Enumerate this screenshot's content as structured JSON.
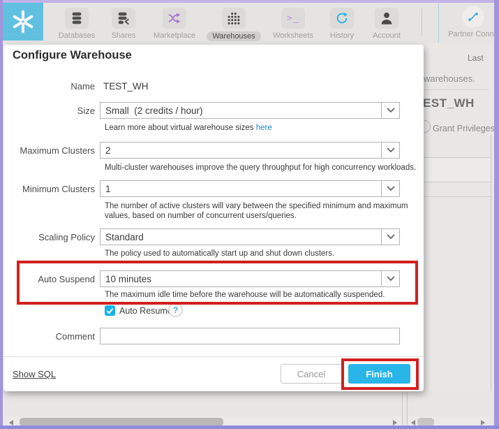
{
  "topbar": {
    "items": [
      {
        "label": "Databases"
      },
      {
        "label": "Shares"
      },
      {
        "label": "Marketplace"
      },
      {
        "label": "Warehouses"
      },
      {
        "label": "Worksheets"
      },
      {
        "label": "History"
      },
      {
        "label": "Account"
      }
    ],
    "partner_connect_label": "Partner Conne",
    "worksheets_glyph": ">_"
  },
  "modal": {
    "title": "Configure Warehouse",
    "name_field": {
      "label": "Name",
      "value": "TEST_WH"
    },
    "size_field": {
      "label": "Size",
      "value": "Small  (2 credits / hour)",
      "help_prefix": "Learn more about virtual warehouse sizes ",
      "help_link": "here"
    },
    "max_clusters_field": {
      "label": "Maximum Clusters",
      "value": "2",
      "help": "Multi-cluster warehouses improve the query throughput for high concurrency workloads."
    },
    "min_clusters_field": {
      "label": "Minimum Clusters",
      "value": "1",
      "help": "The number of active clusters will vary between the specified minimum and maximum values, based on number of concurrent users/queries."
    },
    "scaling_policy_field": {
      "label": "Scaling Policy",
      "value": "Standard",
      "help": "The policy used to automatically start up and shut down clusters."
    },
    "auto_suspend_field": {
      "label": "Auto Suspend",
      "value": "10 minutes",
      "help": "The maximum idle time before the warehouse will be automatically suspended."
    },
    "auto_resume": {
      "label": "Auto Resume",
      "checked": true,
      "help_glyph": "?"
    },
    "comment_field": {
      "label": "Comment",
      "value": ""
    },
    "footer": {
      "show_sql_label": "Show SQL",
      "cancel_label": "Cancel",
      "finish_label": "Finish"
    }
  },
  "right_panel": {
    "last_label": "Last",
    "partial_text": "warehouses.",
    "warehouse_title": "EST_WH",
    "grant_privileges_label": "Grant Privileges"
  },
  "colors": {
    "accent_blue": "#29b5e8",
    "logo_blue": "#61c0e0",
    "highlight_red": "#d1201f",
    "link_blue": "#2086c8",
    "purple_border": "#a295da"
  }
}
